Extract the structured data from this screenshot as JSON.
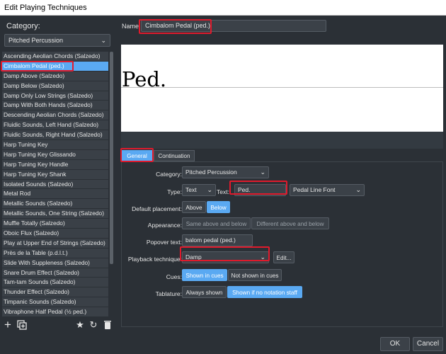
{
  "window": {
    "title": "Edit Playing Techniques"
  },
  "left": {
    "category_label": "Category:",
    "category_value": "Pitched Percussion",
    "items": [
      "Ascending Aeolian Chords (Salzedo)",
      "Cimbalom Pedal (ped.)",
      "Damp Above (Salzedo)",
      "Damp Below (Salzedo)",
      "Damp Only Low Strings (Salzedo)",
      "Damp With Both Hands (Salzedo)",
      "Descending Aeolian Chords (Salzedo)",
      "Fluidic Sounds, Left Hand (Salzedo)",
      "Fluidic Sounds, Right Hand (Salzedo)",
      "Harp Tuning Key",
      "Harp Tuning Key Glissando",
      "Harp Tuning Key Handle",
      "Harp Tuning Key Shank",
      "Isolated Sounds (Salzedo)",
      "Metal Rod",
      "Metallic Sounds (Salzedo)",
      "Metallic Sounds, One String (Salzedo)",
      "Muffle Totally (Salzedo)",
      "Oboic Flux (Salzedo)",
      "Play at Upper End of Strings (Salzedo)",
      "Près de la Table (p.d.l.t.)",
      "Slide With Suppleness (Salzedo)",
      "Snare Drum Effect (Salzedo)",
      "Tam-tam Sounds (Salzedo)",
      "Thunder Effect (Salzedo)",
      "Timpanic Sounds (Salzedo)",
      "Vibraphone Half Pedal (½ ped.)"
    ],
    "selected_index": 1,
    "icons": [
      "plus-icon",
      "duplicate-icon",
      "star-icon",
      "reset-icon",
      "trash-icon"
    ]
  },
  "right": {
    "name_label": "Name:",
    "name_value": "Cimbalom Pedal (ped.)",
    "preview_text": "Ped.",
    "tabs": [
      "General",
      "Continuation"
    ],
    "general": {
      "category_label": "Category:",
      "category_value": "Pitched Percussion",
      "type_label": "Type:",
      "type_value": "Text",
      "text_label": "Text:",
      "text_value": "Ped.",
      "font_value": "Pedal Line Font",
      "placement_label": "Default placement:",
      "placement_options": [
        "Above",
        "Below"
      ],
      "appearance_label": "Appearance:",
      "appearance_options": [
        "Same above and below",
        "Different above and below"
      ],
      "popover_label": "Popover text:",
      "popover_value": "balom pedal (ped.)",
      "playback_label": "Playback technique:",
      "playback_value": "Damp",
      "edit_button": "Edit...",
      "cues_label": "Cues:",
      "cues_options": [
        "Shown in cues",
        "Not shown in cues"
      ],
      "tablature_label": "Tablature:",
      "tablature_options": [
        "Always shown",
        "Shown if no notation staff"
      ]
    },
    "ok_label": "OK",
    "cancel_label": "Cancel"
  },
  "colors": {
    "accent": "#5aa9f2",
    "highlight": "#e01a2c",
    "background": "#2b3036"
  }
}
